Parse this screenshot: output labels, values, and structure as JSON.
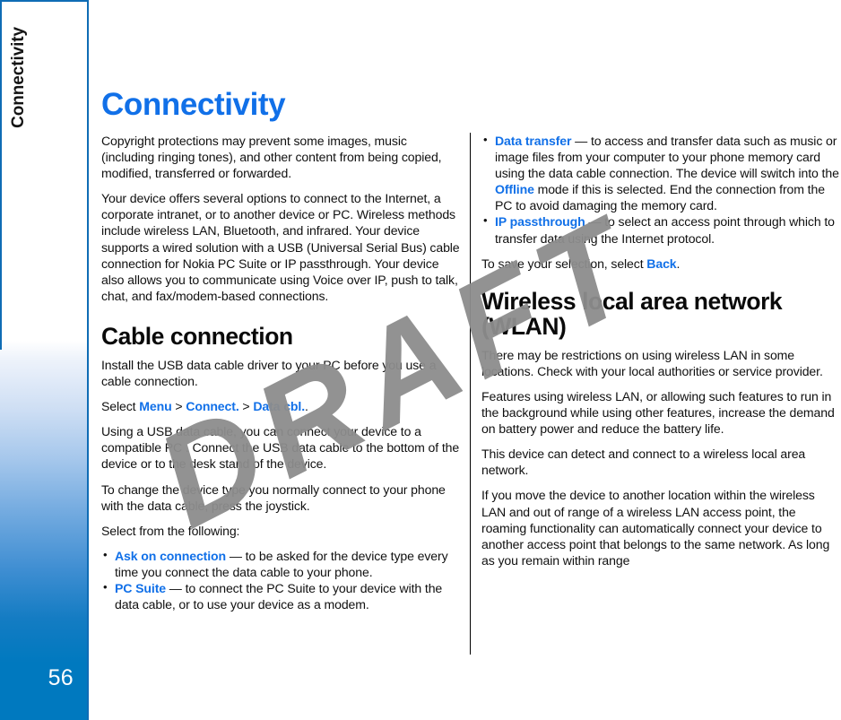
{
  "document": {
    "tab_label": "Connectivity",
    "page_number": "56",
    "title": "Connectivity",
    "watermark": "DRAFT"
  },
  "left_column": {
    "p1": "Copyright protections may prevent some images, music (including ringing tones), and other content from being copied, modified, transferred or forwarded.",
    "p2": "Your device offers several options to connect to the Internet, a corporate intranet, or to another device or PC. Wireless methods include wireless LAN, Bluetooth, and infrared. Your device supports a wired solution with a USB (Universal Serial Bus) cable connection for Nokia PC Suite or IP passthrough. Your device also allows you to communicate using Voice over IP, push to talk, chat, and fax/modem-based connections.",
    "heading_cable": "Cable connection",
    "p3": "Install the USB data cable driver to your PC before you use a cable connection.",
    "select_prefix": "Select ",
    "select_menu": "Menu",
    "select_sep1": " > ",
    "select_connect": "Connect.",
    "select_sep2": " > ",
    "select_datacbl": "Data cbl.",
    "select_suffix": ".",
    "p4": "Using a USB data cable, you can connect your device to a compatible PC . Connect the USB data cable to the bottom of the device or to the desk stand of the device.",
    "p5": "To change the device type you normally connect to your phone with the data cable, press the joystick.",
    "p6": "Select from the following:",
    "bullets": [
      {
        "term": "Ask on connection",
        "text": " — to be asked for the device type every time you connect the data cable to your phone."
      },
      {
        "term": "PC Suite",
        "text": " — to connect the PC Suite to your device with the data cable, or to use your device as a modem."
      }
    ]
  },
  "right_column": {
    "bullets": [
      {
        "term": "Data transfer",
        "text_before": " — to access and transfer data such as music or image files from your computer to your phone memory card using the data cable connection. The device will switch into the ",
        "inline_link": "Offline",
        "text_after": " mode if this is selected. End the connection from the PC to avoid damaging the memory card."
      },
      {
        "term": "IP passthrough",
        "text_before": " — to select an access point through which to transfer data using the Internet protocol.",
        "inline_link": "",
        "text_after": ""
      }
    ],
    "save_prefix": "To save your selection, select ",
    "save_link": "Back",
    "save_suffix": ".",
    "heading_wlan": "Wireless local area network (WLAN)",
    "p1": "There may be restrictions on using wireless LAN in some locations. Check with your local authorities or service provider.",
    "p2": "Features using wireless LAN, or allowing such features to run in the background while using other features, increase the demand on battery power and reduce the battery life.",
    "p3": "This device can detect and connect to a wireless local area network.",
    "p4": "If you move the device to another location within the wireless LAN and out of range of a wireless LAN access point, the roaming functionality can automatically connect your device to another access point that belongs to the same network. As long as you remain within range"
  },
  "colors": {
    "accent_blue": "#1170e8",
    "sidebar_blue": "#0079bf",
    "sidebar_border": "#0f6cb5",
    "text": "#101010",
    "watermark_gray": "#8d8d8d"
  }
}
